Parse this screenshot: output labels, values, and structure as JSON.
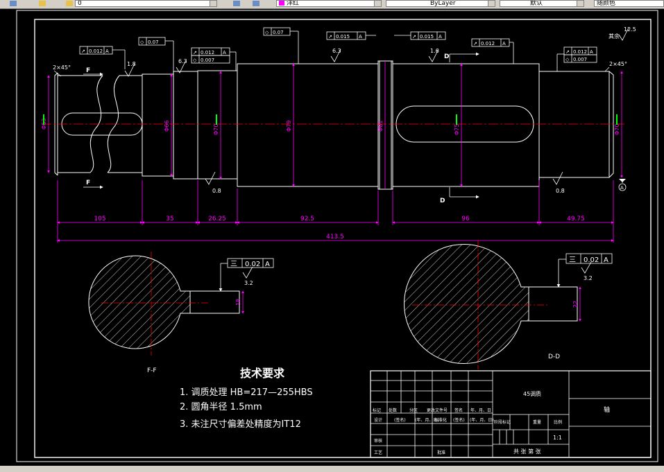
{
  "toolbar": {
    "layer_value": "0",
    "color_value": "洋红",
    "linetype_value": "ByLayer",
    "lineweight_value": "默认",
    "plotstyle_value": "随颜色"
  },
  "colors": {
    "background": "#000000",
    "outline": "#ffffff",
    "dimension": "#ff00ff",
    "centerline": "#ff0000",
    "tolerance_text": "#00ff00"
  },
  "drawing": {
    "chamfer_left": "2×45°",
    "chamfer_right": "2×45°",
    "section_f_label_top": "F",
    "section_f_label_bottom": "F",
    "section_d_label_top": "D",
    "section_d_label_bottom": "D",
    "datum_a": "A",
    "rough_1_8": "1.8",
    "rough_6_3": "6.3",
    "rough_6_3b": "6.3",
    "rough_1_6": "1.6",
    "rough_0_8a": "0.8",
    "rough_0_8b": "0.8",
    "rough_0_8c": "0.8",
    "rough_rest_value": "12.5",
    "rough_rest_label": "其余",
    "fcf_runout_0012": "0.012",
    "fcf_cyl_007a": "0.07",
    "fcf_runout_0012b": "0.012",
    "fcf_cyl_0007a": "0.007",
    "fcf_cyl_007b": "0.07",
    "fcf_runout_0015a": "0.015",
    "fcf_runout_0015b": "0.015",
    "fcf_runout_0012c": "0.012",
    "fcf_runout_0012d": "0.012",
    "fcf_cyl_0007b": "0.007",
    "dia_63": "Φ63",
    "dia_66": "Φ66",
    "dia_70a": "Φ70",
    "dia_79": "Φ79",
    "dia_81": "Φ81",
    "dia_75": "Φ75",
    "dia_70b": "Φ70",
    "dim_105": "105",
    "dim_35": "35",
    "dim_2625": "26.25",
    "dim_925": "92.5",
    "dim_96": "96",
    "dim_4975": "49.75",
    "dim_4135": "413.5",
    "sec_f_tol": "0.02",
    "sec_f_rough": "3.2",
    "sec_f_width": "18",
    "sec_f_name": "F-F",
    "sec_d_tol": "0.02",
    "sec_d_rough": "3.2",
    "sec_d_width": "22",
    "sec_d_name": "D-D"
  },
  "tech_req": {
    "title": "技术要求",
    "item1": "1. 调质处理 HB=217—255HBS",
    "item2": "2. 圆角半径  1.5mm",
    "item3": "3. 未注尺寸偏差处精度为IT12"
  },
  "title_block": {
    "material": "45调质",
    "part_name": "轴",
    "row_labels": [
      "标记",
      "处数",
      "分区",
      "更改文件号",
      "签名",
      "年、月、日"
    ],
    "design": "设计",
    "sign": "(签名)",
    "date": "(年、月、日)",
    "std": "标准化",
    "stage_mark": "阶段标记",
    "weight": "重量",
    "scale_label": "比例",
    "scale": "1:1",
    "check": "审核",
    "approve": "批准",
    "process": "工艺",
    "sheets": "共  张  第  张"
  }
}
